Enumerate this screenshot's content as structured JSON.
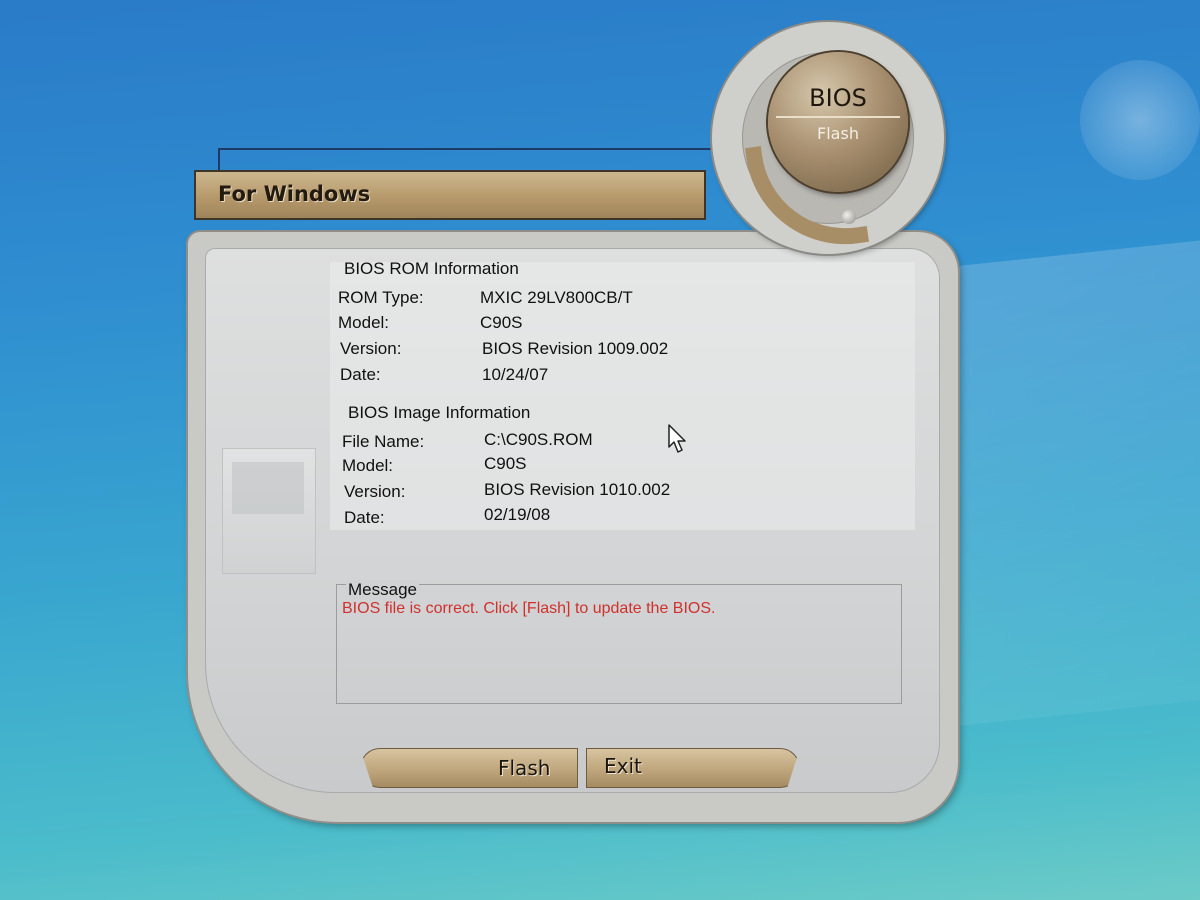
{
  "window": {
    "title": "For Windows",
    "emblem_title": "BIOS",
    "emblem_subtitle": "Flash"
  },
  "rom_info": {
    "heading": "BIOS ROM Information",
    "rows": [
      {
        "label": "ROM Type:",
        "value": "MXIC 29LV800CB/T"
      },
      {
        "label": "Model:",
        "value": "C90S"
      },
      {
        "label": "Version:",
        "value": "BIOS Revision 1009.002"
      },
      {
        "label": "Date:",
        "value": "10/24/07"
      }
    ]
  },
  "image_info": {
    "heading": "BIOS Image Information",
    "rows": [
      {
        "label": "File Name:",
        "value": "C:\\C90S.ROM"
      },
      {
        "label": "Model:",
        "value": "C90S"
      },
      {
        "label": "Version:",
        "value": "BIOS Revision 1010.002"
      },
      {
        "label": "Date:",
        "value": "02/19/08"
      }
    ]
  },
  "message": {
    "legend": "Message",
    "text": "BIOS file is correct. Click [Flash] to update the BIOS.",
    "color": "#d0312d"
  },
  "buttons": {
    "flash_label": "Flash",
    "exit_label": "Exit"
  },
  "icons": {
    "cursor": "mouse-pointer-icon",
    "emblem": "bios-flash-emblem-icon"
  },
  "colors": {
    "accent": "#b89c6e",
    "desktop": "#2f8ed0"
  }
}
